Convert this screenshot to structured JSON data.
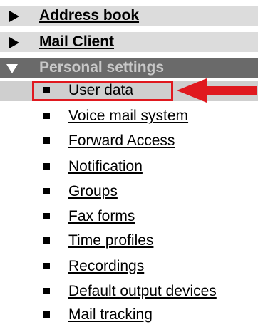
{
  "menu": {
    "sections": [
      {
        "label": "Address book",
        "expanded": false
      },
      {
        "label": "Mail Client",
        "expanded": false
      },
      {
        "label": "Personal settings",
        "expanded": true
      }
    ],
    "personal_settings_items": [
      {
        "label": "User data",
        "selected": true
      },
      {
        "label": "Voice mail system"
      },
      {
        "label": "Forward Access"
      },
      {
        "label": "Notification"
      },
      {
        "label": "Groups"
      },
      {
        "label": "Fax forms"
      },
      {
        "label": "Time profiles"
      },
      {
        "label": "Recordings"
      },
      {
        "label": "Default output devices"
      },
      {
        "label": "Mail tracking"
      }
    ]
  },
  "annotation": {
    "highlight_color": "#e0191f",
    "pointer": "red-arrow-icon"
  },
  "colors": {
    "collapsed_header_bg": "#dcdcdc",
    "expanded_header_bg": "#6a6a6a",
    "selected_item_bg": "#cfcfcf",
    "expanded_header_text": "#c8c8c8"
  }
}
